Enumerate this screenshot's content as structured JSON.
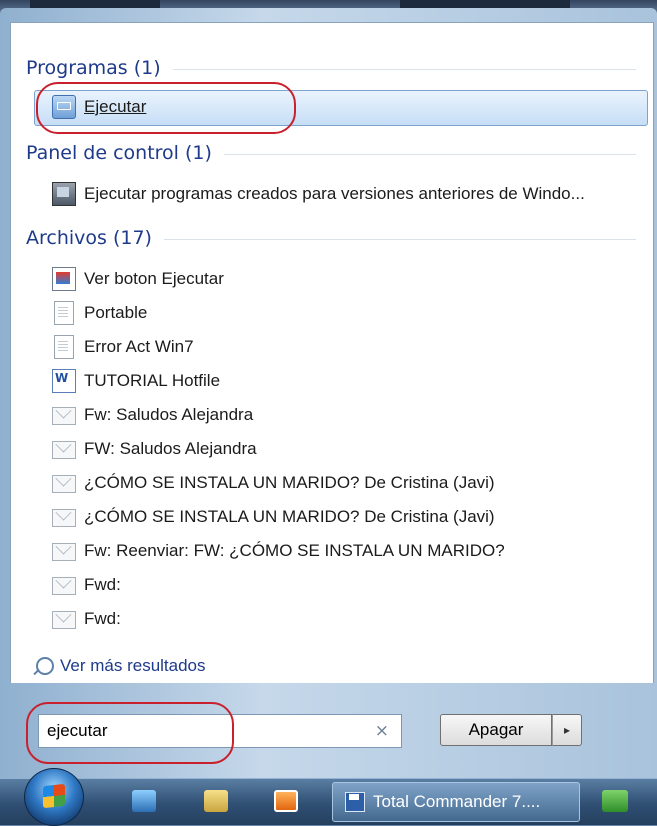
{
  "sections": {
    "programs": {
      "title": "Programas (1)",
      "items": [
        {
          "label": "Ejecutar",
          "icon": "run-icon"
        }
      ]
    },
    "control_panel": {
      "title": "Panel de control (1)",
      "items": [
        {
          "label": "Ejecutar programas creados para versiones anteriores de Windo...",
          "icon": "compatibility-icon"
        }
      ]
    },
    "files": {
      "title": "Archivos (17)",
      "items": [
        {
          "label": "Ver boton Ejecutar",
          "icon": "picture-icon"
        },
        {
          "label": "Portable",
          "icon": "document-icon"
        },
        {
          "label": "Error Act Win7",
          "icon": "document-icon"
        },
        {
          "label": "TUTORIAL Hotfile",
          "icon": "word-icon"
        },
        {
          "label": "Fw: Saludos Alejandra",
          "icon": "mail-icon"
        },
        {
          "label": "FW: Saludos Alejandra",
          "icon": "mail-icon"
        },
        {
          "label": "¿CÓMO SE INSTALA UN MARIDO? De Cristina (Javi)",
          "icon": "mail-icon"
        },
        {
          "label": "¿CÓMO SE INSTALA UN MARIDO? De Cristina (Javi)",
          "icon": "mail-icon"
        },
        {
          "label": "Fw: Reenviar: FW: ¿CÓMO SE INSTALA UN MARIDO?",
          "icon": "mail-icon"
        },
        {
          "label": "Fwd:",
          "icon": "mail-icon"
        },
        {
          "label": "Fwd:",
          "icon": "mail-icon"
        }
      ]
    }
  },
  "more_results": "Ver más resultados",
  "search": {
    "value": "ejecutar",
    "clear": "×"
  },
  "shutdown": {
    "label": "Apagar",
    "arrow": "▸"
  },
  "taskbar": {
    "task_label": "Total Commander 7...."
  },
  "colors": {
    "annotation_circle": "#c8202c",
    "section_title": "#1e3a8a",
    "selection": "#c6def6"
  }
}
